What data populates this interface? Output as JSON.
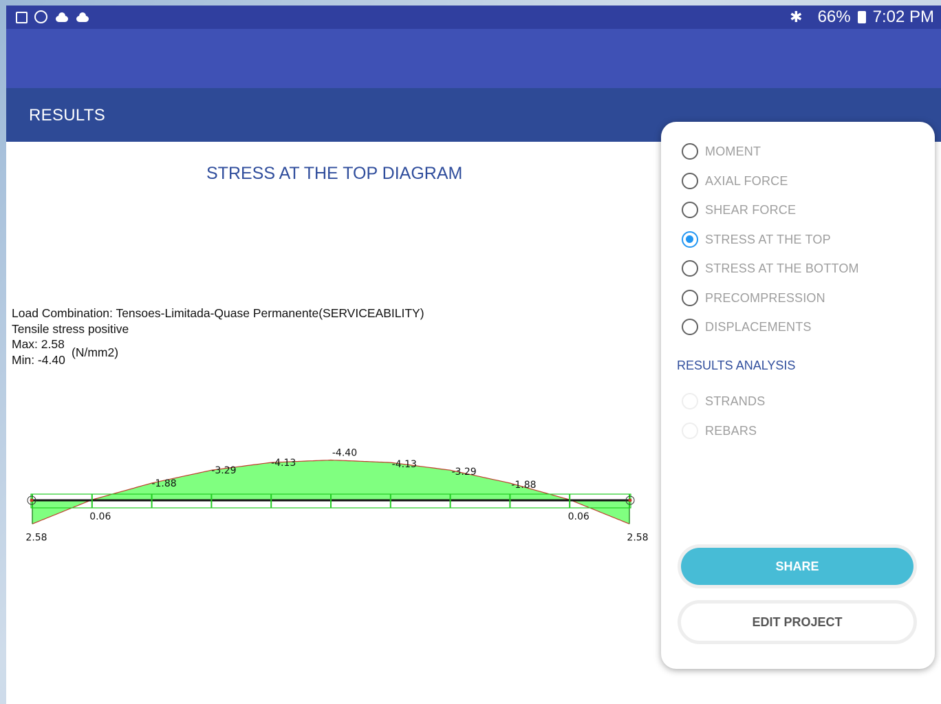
{
  "status_bar": {
    "icons": [
      "image-icon",
      "clock-icon",
      "cloud-icon",
      "cloud-icon"
    ],
    "battery": "66%",
    "time": "7:02 PM"
  },
  "toolbar": {
    "title": "RESULTS"
  },
  "diagram": {
    "title": "STRESS AT THE TOP DIAGRAM",
    "load_combination": "Load Combination: Tensoes-Limitada-Quase Permanente(SERVICEABILITY)",
    "sign_convention": "Tensile stress positive",
    "max": "Max: 2.58",
    "min": "Min: -4.40",
    "unit": "(N/mm2)"
  },
  "chart_data": {
    "type": "area",
    "x": [
      0,
      1,
      2,
      3,
      4,
      5,
      6,
      7,
      8,
      9,
      10
    ],
    "values": [
      2.58,
      -0.06,
      -1.88,
      -3.29,
      -4.13,
      -4.4,
      -4.13,
      -3.29,
      -1.88,
      -0.06,
      2.58
    ],
    "labels": [
      "2.58",
      "0.06",
      "-1.88",
      "-3.29",
      "-4.13",
      "-4.40",
      "-4.13",
      "-3.29",
      "-1.88",
      "0.06",
      "2.58"
    ],
    "fill_color": "#80ff80",
    "outline_color": "#c0392b"
  },
  "options": [
    {
      "label": "MOMENT",
      "checked": false,
      "enabled": true
    },
    {
      "label": "AXIAL FORCE",
      "checked": false,
      "enabled": true
    },
    {
      "label": "SHEAR FORCE",
      "checked": false,
      "enabled": true
    },
    {
      "label": "STRESS AT THE TOP",
      "checked": true,
      "enabled": true
    },
    {
      "label": "STRESS AT THE BOTTOM",
      "checked": false,
      "enabled": true
    },
    {
      "label": "PRECOMPRESSION",
      "checked": false,
      "enabled": true
    },
    {
      "label": "DISPLACEMENTS",
      "checked": false,
      "enabled": true
    }
  ],
  "results_analysis": {
    "heading": "RESULTS ANALYSIS",
    "options": [
      {
        "label": "STRANDS",
        "enabled": false
      },
      {
        "label": "REBARS",
        "enabled": false
      }
    ]
  },
  "buttons": {
    "share": "SHARE",
    "edit_project": "EDIT PROJECT"
  },
  "colors": {
    "primary": "#3f51b5",
    "primary_dark": "#303f9f",
    "toolbar": "#2e4a96",
    "accent": "#2196f3",
    "share": "#47bcd6"
  }
}
